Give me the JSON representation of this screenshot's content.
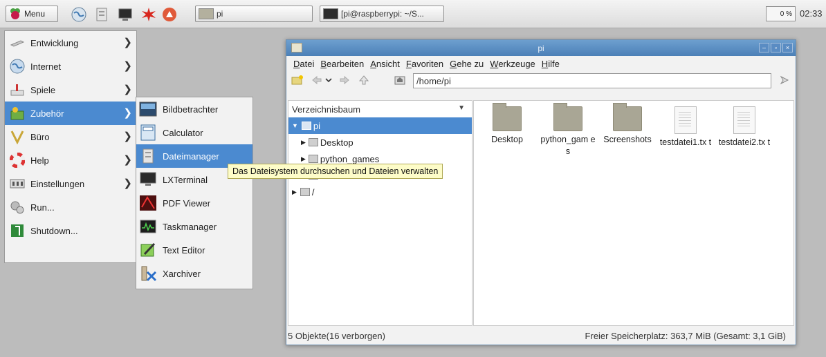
{
  "taskbar": {
    "menu_label": "Menu",
    "tasks": [
      {
        "label": "pi"
      },
      {
        "label": "[pi@raspberrypi: ~/S..."
      }
    ],
    "cpu_label": "0 %",
    "clock": "02:33"
  },
  "start_menu": {
    "items": [
      {
        "label": "Entwicklung"
      },
      {
        "label": "Internet"
      },
      {
        "label": "Spiele"
      },
      {
        "label": "Zubehör"
      },
      {
        "label": "Büro"
      },
      {
        "label": "Help"
      },
      {
        "label": "Einstellungen"
      },
      {
        "label": "Run..."
      },
      {
        "label": "Shutdown..."
      }
    ],
    "submenu": [
      {
        "label": "Bildbetrachter"
      },
      {
        "label": "Calculator"
      },
      {
        "label": "Dateimanager"
      },
      {
        "label": "LXTerminal"
      },
      {
        "label": "PDF Viewer"
      },
      {
        "label": "Taskmanager"
      },
      {
        "label": "Text Editor"
      },
      {
        "label": "Xarchiver"
      }
    ],
    "tooltip": "Das Dateisystem durchsuchen und Dateien verwalten"
  },
  "file_manager": {
    "title": "pi",
    "menu": [
      "Datei",
      "Bearbeiten",
      "Ansicht",
      "Favoriten",
      "Gehe zu",
      "Werkzeuge",
      "Hilfe"
    ],
    "path": "/home/pi",
    "side_selector": "Verzeichnisbaum",
    "tree": [
      {
        "label": "pi"
      },
      {
        "label": "Desktop"
      },
      {
        "label": "python_games"
      },
      {
        "label": "Screenshots"
      },
      {
        "label": "/"
      }
    ],
    "files": [
      {
        "label": "Desktop",
        "kind": "folder"
      },
      {
        "label": "python_gam es",
        "kind": "folder"
      },
      {
        "label": "Screenshots",
        "kind": "folder"
      },
      {
        "label": "testdatei1.tx t",
        "kind": "text"
      },
      {
        "label": "testdatei2.tx t",
        "kind": "text"
      }
    ],
    "status_left": "5 Objekte(16 verborgen)",
    "status_right": "Freier Speicherplatz: 363,7 MiB (Gesamt: 3,1 GiB)"
  },
  "colors": {
    "selection": "#4b8ad0",
    "titlebar": "#4c80b7",
    "tooltip": "#fdfcc8"
  }
}
